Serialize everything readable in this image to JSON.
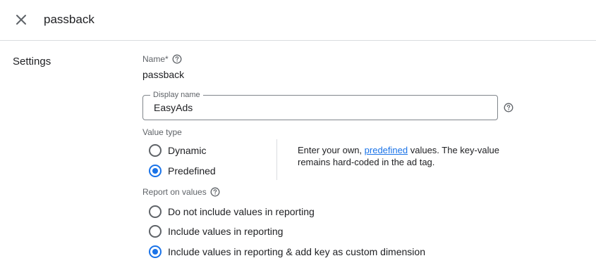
{
  "header": {
    "close_icon": "close-icon",
    "title": "passback"
  },
  "section": {
    "title": "Settings"
  },
  "name": {
    "label": "Name*",
    "help_icon": "help-circle-icon",
    "value": "passback"
  },
  "display_name": {
    "label": "Display name",
    "value": "EasyAds",
    "help_icon": "help-circle-icon"
  },
  "value_type": {
    "label": "Value type",
    "options": [
      {
        "label": "Dynamic",
        "selected": false
      },
      {
        "label": "Predefined",
        "selected": true
      }
    ],
    "description": {
      "before": "Enter your own, ",
      "link": "predefined",
      "after": " values. The key-value remains hard-coded in the ad tag."
    }
  },
  "report_on_values": {
    "label": "Report on values",
    "help_icon": "help-circle-icon",
    "options": [
      {
        "label": "Do not include values in reporting",
        "selected": false
      },
      {
        "label": "Include values in reporting",
        "selected": false
      },
      {
        "label": "Include values in reporting & add key as custom dimension",
        "selected": true
      }
    ]
  },
  "colors": {
    "accent": "#1a73e8",
    "text": "#202124",
    "secondary_text": "#5f6368",
    "divider": "#dadce0"
  }
}
